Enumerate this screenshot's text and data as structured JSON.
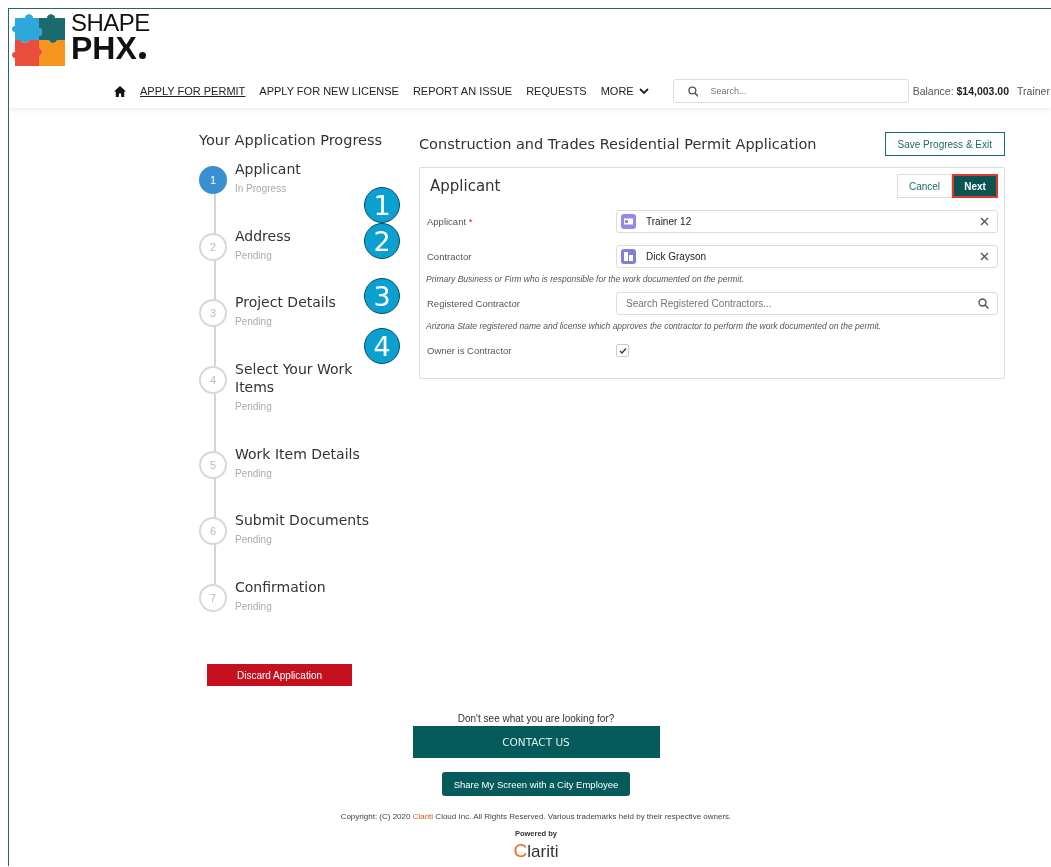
{
  "logo": {
    "line1": "SHAPE",
    "line2": "PHX"
  },
  "nav": {
    "items": [
      {
        "label": "APPLY FOR PERMIT",
        "selected": true
      },
      {
        "label": "APPLY FOR NEW LICENSE",
        "selected": false
      },
      {
        "label": "REPORT AN ISSUE",
        "selected": false
      },
      {
        "label": "REQUESTS",
        "selected": false
      },
      {
        "label": "MORE",
        "selected": false,
        "kind": "dropdown"
      }
    ],
    "search": {
      "placeholder": "Search..."
    },
    "balance_label": "Balance:",
    "balance": "$14,003.00",
    "user": "Trainer"
  },
  "progress": {
    "title": "Your Application Progress",
    "steps": [
      {
        "number": "1",
        "label": "Applicant",
        "status": "In Progress",
        "selected": true
      },
      {
        "number": "2",
        "label": "Address",
        "status": "Pending",
        "selected": false
      },
      {
        "number": "3",
        "label": "Project Details",
        "status": "Pending",
        "selected": false
      },
      {
        "number": "4",
        "label": "Select Your Work Items",
        "status": "Pending",
        "selected": false
      },
      {
        "number": "5",
        "label": "Work Item Details",
        "status": "Pending",
        "selected": false
      },
      {
        "number": "6",
        "label": "Submit Documents",
        "status": "Pending",
        "selected": false
      },
      {
        "number": "7",
        "label": "Confirmation",
        "status": "Pending",
        "selected": false
      }
    ],
    "discard": "Discard Application"
  },
  "form": {
    "title": "Construction and Trades Residential Permit Application",
    "save": "Save Progress & Exit",
    "section": "Applicant",
    "cancel": "Cancel",
    "next": "Next",
    "fields": [
      {
        "kind": "lookup",
        "callout": "1",
        "label": "Applicant",
        "required_mark": "*",
        "value": "Trainer 12"
      },
      {
        "kind": "lookup",
        "callout": "2",
        "label": "Contractor",
        "value": "Dick Grayson",
        "help": "Primary Business or Firm who is responsible for the work documented on the permit."
      },
      {
        "kind": "search",
        "callout": "3",
        "label": "Registered Contractor",
        "placeholder": "Search Registered Contractors...",
        "help": "Arizona State registered name and license which approves the contractor to perform the work documented on the permit."
      },
      {
        "kind": "checkbox",
        "callout": "4",
        "label": "Owner is Contractor",
        "checked": true
      }
    ]
  },
  "footer": {
    "question": "Don't see what you are looking for?",
    "contact": "CONTACT US",
    "share": "Share My Screen with a City Employee",
    "copyright_before": "Copyright: (C) 2020 ",
    "copyright_link": "Clariti",
    "copyright_after": " Cloud Inc. All Rights Reserved. Various trademarks held by their respective owners.",
    "powered": "Powered by",
    "brand_first": "C",
    "brand_rest": "lariti"
  }
}
